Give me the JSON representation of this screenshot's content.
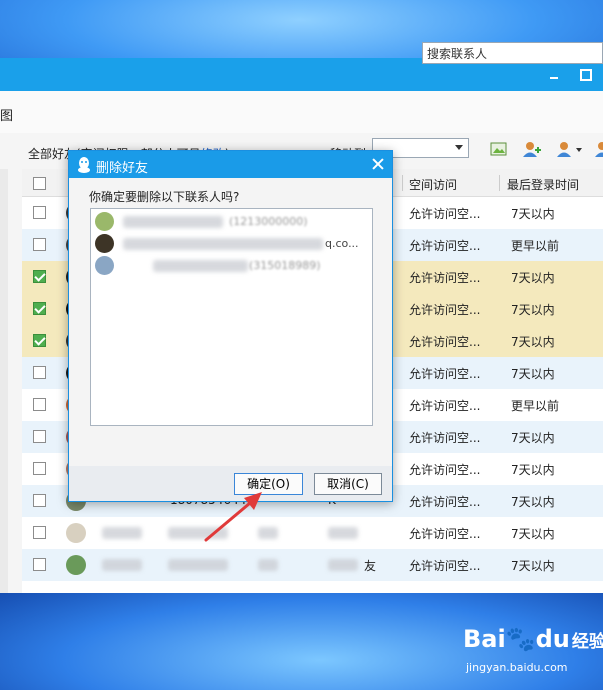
{
  "app": {
    "view_tab": "图",
    "search_placeholder": "搜索联系人",
    "group_label_prefix": "全部好友(空间权限：部分人可见",
    "group_label_link": "修改",
    "group_label_suffix": ")",
    "move_to_label": "移动到"
  },
  "table": {
    "headers": [
      "空间访问",
      "最后登录时间"
    ],
    "rows": [
      {
        "checked": false,
        "selected": false,
        "alt": false,
        "space": "允许访问空...",
        "last": "7天以内"
      },
      {
        "checked": false,
        "selected": false,
        "alt": true,
        "space": "允许访问空...",
        "last": "更早以前"
      },
      {
        "checked": true,
        "selected": true,
        "alt": false,
        "space": "允许访问空...",
        "last": "7天以内"
      },
      {
        "checked": true,
        "selected": true,
        "alt": false,
        "space": "允许访问空...",
        "last": "7天以内"
      },
      {
        "checked": true,
        "selected": true,
        "alt": false,
        "space": "允许访问空...",
        "last": "7天以内"
      },
      {
        "checked": false,
        "selected": false,
        "alt": true,
        "space": "允许访问空...",
        "last": "7天以内"
      },
      {
        "checked": false,
        "selected": false,
        "alt": false,
        "space": "允许访问空...",
        "last": "更早以前"
      },
      {
        "checked": false,
        "selected": false,
        "alt": true,
        "space": "允许访问空...",
        "last": "7天以内"
      },
      {
        "checked": false,
        "selected": false,
        "alt": false,
        "space": "允许访问空...",
        "last": "7天以内"
      },
      {
        "checked": false,
        "selected": false,
        "alt": true,
        "space": "允许访问空...",
        "last": "7天以内"
      },
      {
        "checked": false,
        "selected": false,
        "alt": false,
        "space": "允许访问空...",
        "last": "7天以内"
      },
      {
        "checked": false,
        "selected": false,
        "alt": true,
        "space": "允许访问空...",
        "last": "7天以内"
      }
    ],
    "partial": {
      "number": "1807854644",
      "remark_k": "K",
      "remark_you": "友"
    }
  },
  "dialog": {
    "title": "删除好友",
    "question": "你确定要删除以下联系人吗?",
    "items": [
      {
        "text": "(1213000000)"
      },
      {
        "text": "q.co..."
      },
      {
        "text": "(315018989)"
      }
    ],
    "ok_label": "确定(O)",
    "cancel_label": "取消(C)"
  },
  "watermark": {
    "logo": "Bai",
    "logo_mid": "du",
    "logo_cn": "经验",
    "url": "jingyan.baidu.com"
  },
  "colors": {
    "titlebar": "#1aa0ea",
    "selected_row": "#f4e9bd",
    "alt_row": "#e9f3fb",
    "checkbox_on": "#4fae4f",
    "arrow": "#e03a3a"
  }
}
